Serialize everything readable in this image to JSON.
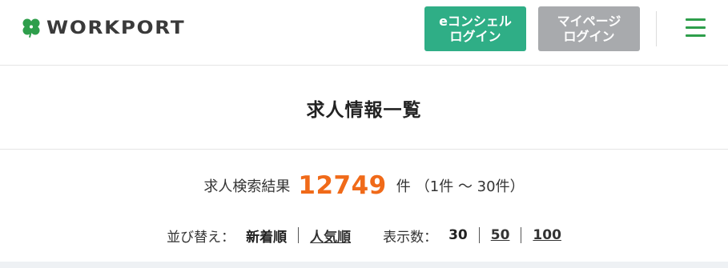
{
  "header": {
    "logo_text": "WORKPORT",
    "econ_login_line1": "eコンシェル",
    "econ_login_line2": "ログイン",
    "mypage_login_line1": "マイページ",
    "mypage_login_line2": "ログイン"
  },
  "page": {
    "title": "求人情報一覧"
  },
  "results": {
    "label": "求人検索結果",
    "count": "12749",
    "unit": "件",
    "range": "（1件 〜 30件）"
  },
  "sort": {
    "label": "並び替え：",
    "options": [
      "新着順",
      "人気順"
    ],
    "selected": "新着順",
    "display_label": "表示数：",
    "display_options": [
      "30",
      "50",
      "100"
    ],
    "display_selected": "30"
  },
  "colors": {
    "brand_green": "#2e9e4b",
    "econ_button": "#2fae86",
    "mypage_button": "#a8aaad",
    "count_orange": "#f06a19"
  },
  "icons": {
    "logo": "clover-icon",
    "menu": "hamburger-menu-icon"
  }
}
